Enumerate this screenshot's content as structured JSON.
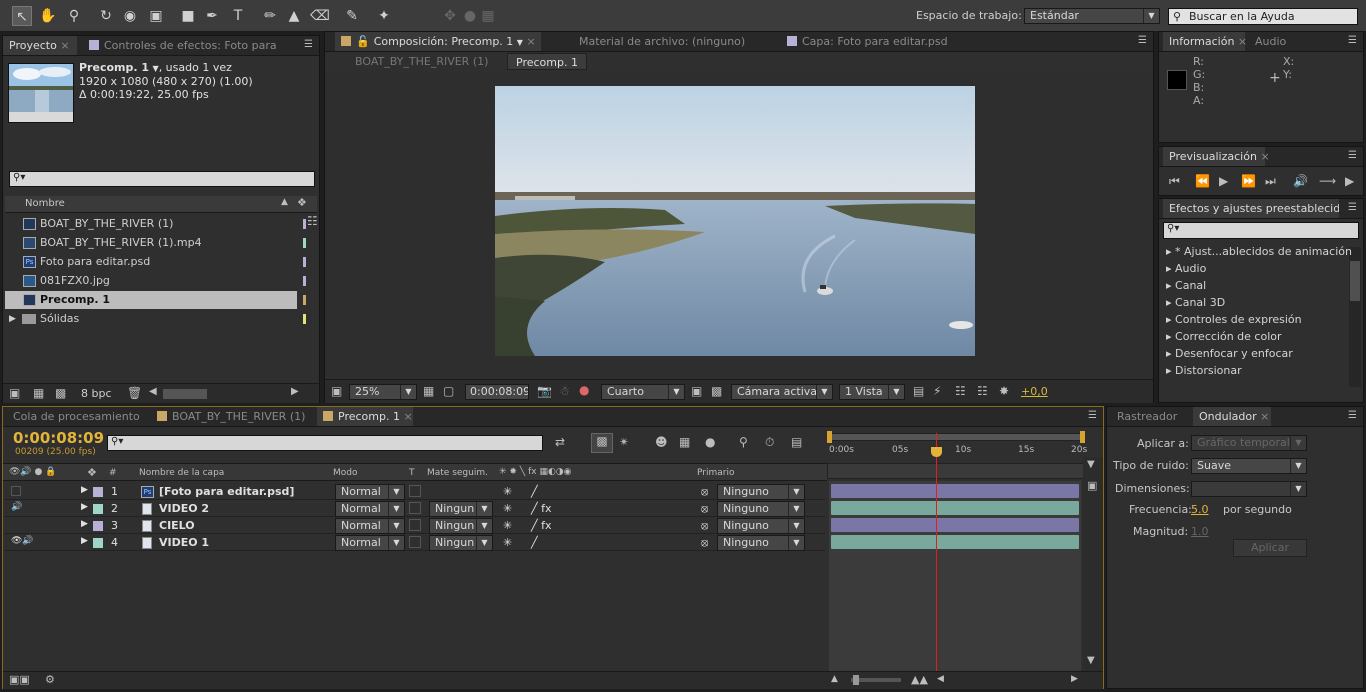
{
  "workspace": {
    "label": "Espacio de trabajo:",
    "value": "Estándar",
    "search_placeholder": "Buscar en la Ayuda"
  },
  "project_panel": {
    "tabs": [
      "Proyecto",
      "Controles de efectos: Foto para"
    ],
    "selected_name": "Precomp. 1",
    "usage": ", usado 1 vez",
    "dimensions": "1920 x 1080  (480 x 270) (1.00)",
    "duration": "Δ 0:00:19:22, 25.00 fps",
    "column_name": "Nombre",
    "items": [
      {
        "name": "BOAT_BY_THE_RIVER (1)",
        "icon": "composition-icon",
        "color": "#b9b0d8"
      },
      {
        "name": "BOAT_BY_THE_RIVER (1).mp4",
        "icon": "footage-icon",
        "color": "#9fd6c9"
      },
      {
        "name": "Foto para editar.psd",
        "icon": "psd-icon",
        "color": "#b9b0d8"
      },
      {
        "name": "081FZX0.jpg",
        "icon": "image-icon",
        "color": "#b9b0d8"
      },
      {
        "name": "Precomp. 1",
        "icon": "composition-icon",
        "color": "#c8a864"
      },
      {
        "name": "Sólidas",
        "icon": "folder-icon",
        "color": "#e8e07a"
      }
    ],
    "bpc": "8 bpc"
  },
  "comp_panel": {
    "tabs": [
      "Composición: Precomp. 1",
      "Material de archivo: (ninguno)",
      "Capa: Foto para editar.psd"
    ],
    "breadcrumbs": [
      "BOAT_BY_THE_RIVER (1)",
      "Precomp. 1"
    ],
    "zoom": "25%",
    "timecode": "0:00:08:09",
    "resolution": "Cuarto",
    "camera": "Cámara activa",
    "views": "1 Vista",
    "exposure": "+0,0"
  },
  "info_panel": {
    "tabs": [
      "Información",
      "Audio"
    ],
    "labels": [
      "R:",
      "G:",
      "B:",
      "A:"
    ],
    "xy": [
      "X:",
      "Y:"
    ]
  },
  "preview_panel": {
    "tab": "Previsualización"
  },
  "effects_panel": {
    "tab": "Efectos y ajustes preestablecidos",
    "items": [
      "* Ajust...ablecidos de animación",
      "Audio",
      "Canal",
      "Canal 3D",
      "Controles de expresión",
      "Corrección de color",
      "Desenfocar y enfocar",
      "Distorsionar"
    ]
  },
  "timeline": {
    "tabs": [
      "Cola de procesamiento",
      "BOAT_BY_THE_RIVER (1)",
      "Precomp. 1"
    ],
    "timecode": "0:00:08:09",
    "frames": "00209 (25.00 fps)",
    "col_layer_name": "Nombre de la capa",
    "col_mode": "Modo",
    "col_t": "T",
    "col_matte": "Mate seguim.",
    "col_parent": "Primario",
    "ruler": [
      "0:00s",
      "05s",
      "10s",
      "15s",
      "20s"
    ],
    "current_time_s": 8.36,
    "duration_s": 19.88,
    "layers": [
      {
        "num": "1",
        "name": "[Foto para editar.psd]",
        "mode": "Normal",
        "matte": "",
        "parent": "Ninguno",
        "color": "#b9b0d8",
        "bar": "#7a76a6"
      },
      {
        "num": "2",
        "name": "VIDEO 2",
        "mode": "Normal",
        "matte": "Ningun",
        "parent": "Ninguno",
        "color": "#9fd6c9",
        "bar": "#79a89c"
      },
      {
        "num": "3",
        "name": "CIELO",
        "mode": "Normal",
        "matte": "Ningun",
        "parent": "Ninguno",
        "color": "#b9b0d8",
        "bar": "#7a76a6"
      },
      {
        "num": "4",
        "name": "VIDEO 1",
        "mode": "Normal",
        "matte": "Ningun",
        "parent": "Ninguno",
        "color": "#9fd6c9",
        "bar": "#79a89c"
      }
    ]
  },
  "wiggler": {
    "tabs": [
      "Rastreador",
      "Ondulador"
    ],
    "apply_label": "Aplicar a:",
    "apply_value": "Gráfico temporal",
    "noise_label": "Tipo de ruido:",
    "noise_value": "Suave",
    "dims_label": "Dimensiones:",
    "freq_label": "Frecuencia:",
    "freq_value": "5.0",
    "freq_unit": "por segundo",
    "mag_label": "Magnitud:",
    "mag_value": "1.0",
    "apply_button": "Aplicar"
  }
}
